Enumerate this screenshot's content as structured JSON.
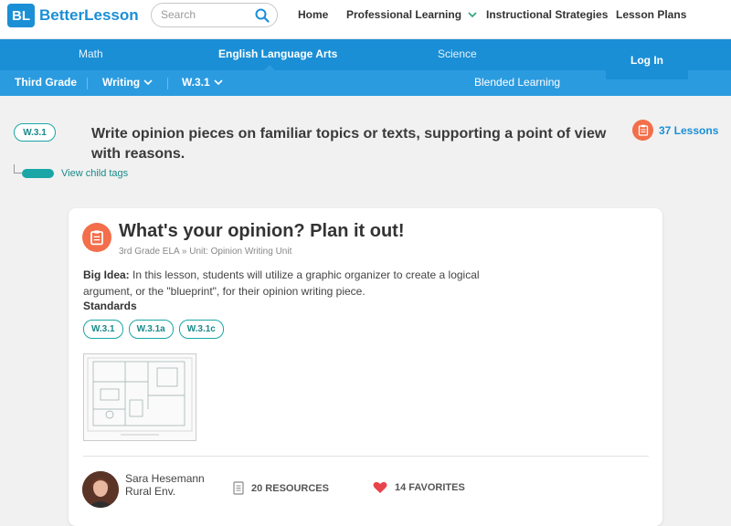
{
  "brand": {
    "badge": "BL",
    "name": "BetterLesson"
  },
  "search": {
    "placeholder": "Search"
  },
  "topnav": {
    "home": "Home",
    "professional_learning": "Professional Learning",
    "instructional_strategies": "Instructional Strategies",
    "lesson_plans": "Lesson Plans"
  },
  "subjects": {
    "math": "Math",
    "ela": "English Language Arts",
    "science": "Science",
    "login": "Log In"
  },
  "gradebar": {
    "grade": "Third Grade",
    "category": "Writing",
    "standard": "W.3.1",
    "blended": "Blended Learning"
  },
  "standard_header": {
    "code": "W.3.1",
    "title": "Write opinion pieces on familiar topics or texts, supporting a point of view with reasons.",
    "lessons_count": "37 Lessons",
    "child_tags": "View child tags"
  },
  "lesson_card": {
    "title": "What's your opinion? Plan it out!",
    "subtitle": "3rd Grade ELA » Unit: Opinion Writing Unit",
    "big_idea_label": "Big Idea:",
    "big_idea_text": "In this lesson, students will utilize a graphic organizer to create a logical argument, or the \"blueprint\", for their opinion writing piece.",
    "standards_label": "Standards",
    "standards": [
      "W.3.1",
      "W.3.1a",
      "W.3.1c"
    ],
    "author_name": "Sara Hesemann",
    "author_school": "Rural Env.",
    "resources": "20 RESOURCES",
    "favorites": "14 FAVORITES"
  },
  "colors": {
    "brand_blue": "#1a8fd6",
    "teal": "#1aa6a6",
    "orange": "#f36e4a",
    "heart": "#e9434b",
    "green_chevron": "#2fa37a"
  },
  "icons": [
    "search-icon",
    "chevron-down-icon",
    "clipboard-icon",
    "document-icon",
    "heart-icon"
  ]
}
